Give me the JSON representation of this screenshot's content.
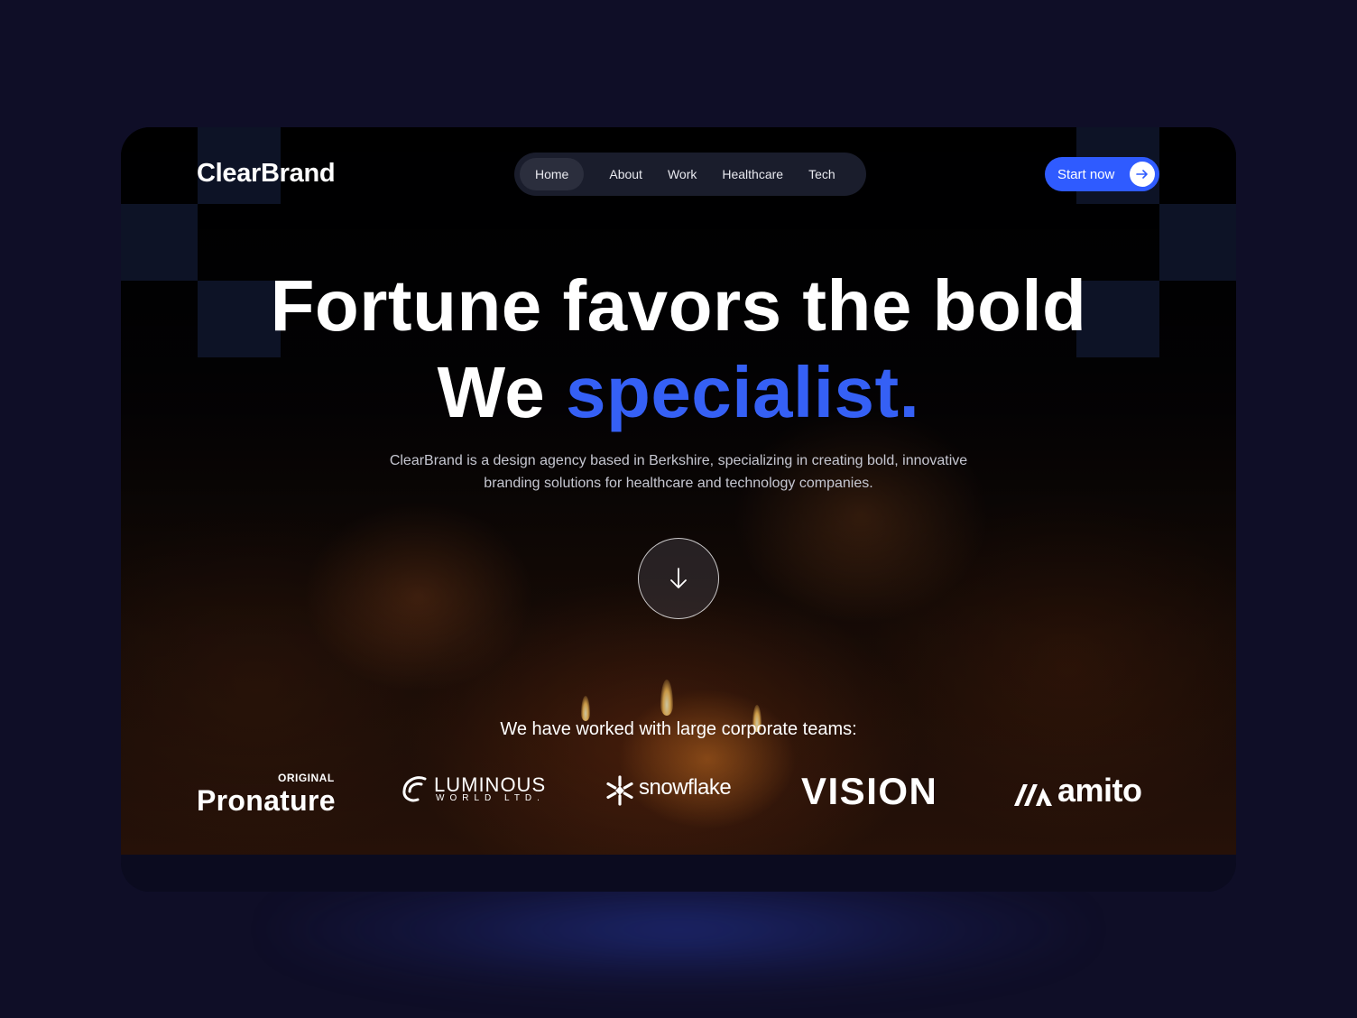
{
  "brand": {
    "name": "ClearBrand"
  },
  "nav": {
    "items": [
      {
        "label": "Home",
        "active": true
      },
      {
        "label": "About"
      },
      {
        "label": "Work"
      },
      {
        "label": "Healthcare"
      },
      {
        "label": "Tech"
      }
    ]
  },
  "cta": {
    "label": "Start now",
    "icon": "arrow-right-icon"
  },
  "hero": {
    "line1": "Fortune favors the bold",
    "line2_lead": "We",
    "line2_accent": "specialist.",
    "description_line1": "ClearBrand is a design agency based in Berkshire, specializing in creating bold, innovative",
    "description_line2": "branding solutions for healthcare and technology companies.",
    "scroll_icon": "arrow-down-icon"
  },
  "clients": {
    "heading": "We have worked with large corporate teams:",
    "logos": [
      {
        "name": "Pronature",
        "tag": "ORIGINAL"
      },
      {
        "name": "LUMINOUS",
        "tag": "WORLD LTD."
      },
      {
        "name": "snowflake"
      },
      {
        "name": "VISION"
      },
      {
        "name": "amito"
      }
    ]
  },
  "colors": {
    "background": "#0f0e27",
    "accent": "#3560f5",
    "button": "#2f5bff",
    "nav_pill": "#1a1d2c"
  }
}
